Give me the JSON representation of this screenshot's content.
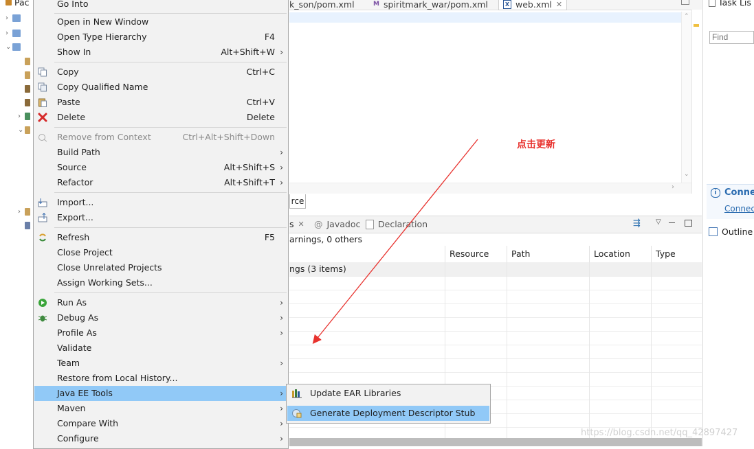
{
  "package_explorer": {
    "tab_label": "Pac"
  },
  "editor": {
    "tabs": [
      {
        "label": "k_son/pom.xml",
        "icon": "maven-icon"
      },
      {
        "label": "spiritmark_war/pom.xml",
        "icon": "maven-icon"
      },
      {
        "label": "web.xml",
        "icon": "xml-file-icon",
        "active": true
      }
    ],
    "source_tab_label": "rce"
  },
  "problems_view": {
    "tabs": [
      {
        "label": "s"
      },
      {
        "label": "Javadoc"
      },
      {
        "label": "Declaration"
      }
    ],
    "summary": "arnings, 0 others",
    "columns": [
      "Resource",
      "Path",
      "Location",
      "Type"
    ],
    "first_row": "ngs (3 items)"
  },
  "right_panel": {
    "task_list_label": "Task Lis",
    "find_placeholder": "Find",
    "connect_title": "Conne",
    "connect_link": "Connec",
    "outline_label": "Outline"
  },
  "annotation_text": "点击更新",
  "context_menu": {
    "items": [
      {
        "label": "Go Into"
      },
      {
        "label": "Open in New Window"
      },
      {
        "label": "Open Type Hierarchy",
        "accel": "F4"
      },
      {
        "label": "Show In",
        "accel": "Alt+Shift+W",
        "submenu": true
      },
      {
        "label": "Copy",
        "accel": "Ctrl+C",
        "icon": "copy-icon"
      },
      {
        "label": "Copy Qualified Name",
        "icon": "copy-qualified-name-icon"
      },
      {
        "label": "Paste",
        "accel": "Ctrl+V",
        "icon": "paste-icon"
      },
      {
        "label": "Delete",
        "accel": "Delete",
        "icon": "delete-icon"
      },
      {
        "label": "Remove from Context",
        "accel": "Ctrl+Alt+Shift+Down",
        "disabled": true,
        "icon": "remove-context-icon"
      },
      {
        "label": "Build Path",
        "submenu": true
      },
      {
        "label": "Source",
        "accel": "Alt+Shift+S",
        "submenu": true
      },
      {
        "label": "Refactor",
        "accel": "Alt+Shift+T",
        "submenu": true
      },
      {
        "label": "Import...",
        "icon": "import-icon"
      },
      {
        "label": "Export...",
        "icon": "export-icon"
      },
      {
        "label": "Refresh",
        "accel": "F5",
        "icon": "refresh-icon"
      },
      {
        "label": "Close Project"
      },
      {
        "label": "Close Unrelated Projects"
      },
      {
        "label": "Assign Working Sets..."
      },
      {
        "label": "Run As",
        "submenu": true,
        "icon": "run-icon"
      },
      {
        "label": "Debug As",
        "submenu": true,
        "icon": "debug-icon"
      },
      {
        "label": "Profile As",
        "submenu": true
      },
      {
        "label": "Validate"
      },
      {
        "label": "Team",
        "submenu": true
      },
      {
        "label": "Restore from Local History..."
      },
      {
        "label": "Java EE Tools",
        "submenu": true,
        "highlighted": true
      },
      {
        "label": "Maven",
        "submenu": true
      },
      {
        "label": "Compare With",
        "submenu": true
      },
      {
        "label": "Configure",
        "submenu": true
      }
    ]
  },
  "submenu": {
    "items": [
      {
        "label": "Update EAR Libraries",
        "icon": "ear-libraries-icon"
      },
      {
        "label": "Generate Deployment Descriptor Stub",
        "icon": "deployment-descriptor-icon",
        "highlighted": true
      }
    ]
  },
  "watermark": "https://blog.csdn.net/qq_42897427",
  "colors": {
    "menu_background": "#f2f2f2",
    "menu_highlight": "#91c9f7",
    "annotation": "#e8322e",
    "arrow": "#e8322e"
  }
}
